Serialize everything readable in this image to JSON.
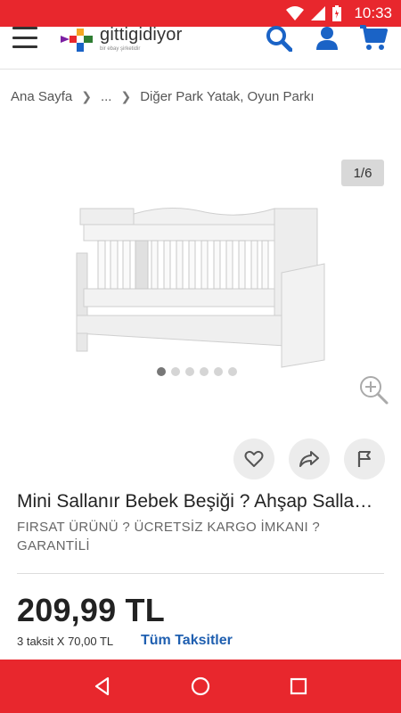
{
  "status_bar": {
    "time": "10:33",
    "color": "#e8272d"
  },
  "header": {
    "logo_text": "gittigidiyor",
    "logo_tagline": "bir ebay şirketidir",
    "icons": [
      "menu-icon",
      "search-icon",
      "user-icon",
      "cart-icon"
    ]
  },
  "breadcrumb": {
    "items": [
      "Ana Sayfa",
      "...",
      "Diğer Park Yatak, Oyun Parkı"
    ]
  },
  "gallery": {
    "counter": "1/6",
    "dot_count": 6,
    "active_dot": 0
  },
  "product": {
    "title": "Mini Sallanır Bebek Beşiği ? Ahşap Sallanır Beşik",
    "subtitle": "FIRSAT ÜRÜNÜ ? ÜCRETSİZ KARGO İMKANI ? GARANTİLİ",
    "price": "209,99 TL",
    "installment": "3 taksit X 70,00 TL",
    "all_installments_link": "Tüm Taksitler"
  },
  "colors": {
    "brand_red": "#e8272d",
    "link_blue": "#1f5fb0",
    "icon_blue": "#1a63c6"
  }
}
